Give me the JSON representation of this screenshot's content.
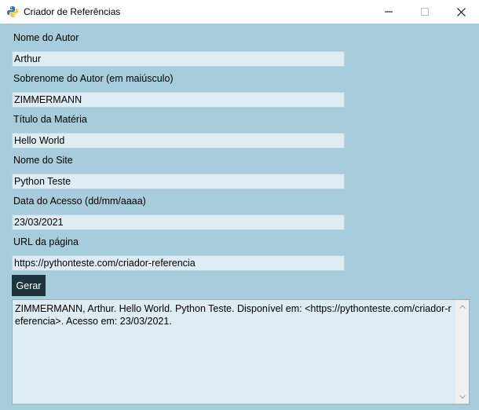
{
  "window": {
    "title": "Criador de Referências",
    "app_icon": "python-icon",
    "controls": [
      "minimize-icon",
      "maximize-icon",
      "close-icon"
    ]
  },
  "form": {
    "nome_autor": {
      "label": "Nome do Autor",
      "value": "Arthur"
    },
    "sobrenome_autor": {
      "label": "Sobrenome do Autor (em maiúsculo)",
      "value": "ZIMMERMANN"
    },
    "titulo_materia": {
      "label": "Título da Matéria",
      "value": "Hello World"
    },
    "nome_site": {
      "label": "Nome do Site",
      "value": "Python Teste"
    },
    "data_acesso": {
      "label": "Data do Acesso (dd/mm/aaaa)",
      "value": "23/03/2021"
    },
    "url_pagina": {
      "label": "URL da página",
      "value": "https://pythonteste.com/criador-referencia"
    }
  },
  "actions": {
    "gerar_label": "Gerar"
  },
  "output": {
    "text": "ZIMMERMANN, Arthur. Hello World. Python Teste. Disponível em: <https://pythonteste.com/criador-referencia>. Acesso em: 23/03/2021."
  },
  "colors": {
    "background": "#a7cddc",
    "field": "#deedf3",
    "button": "#1f333d"
  }
}
